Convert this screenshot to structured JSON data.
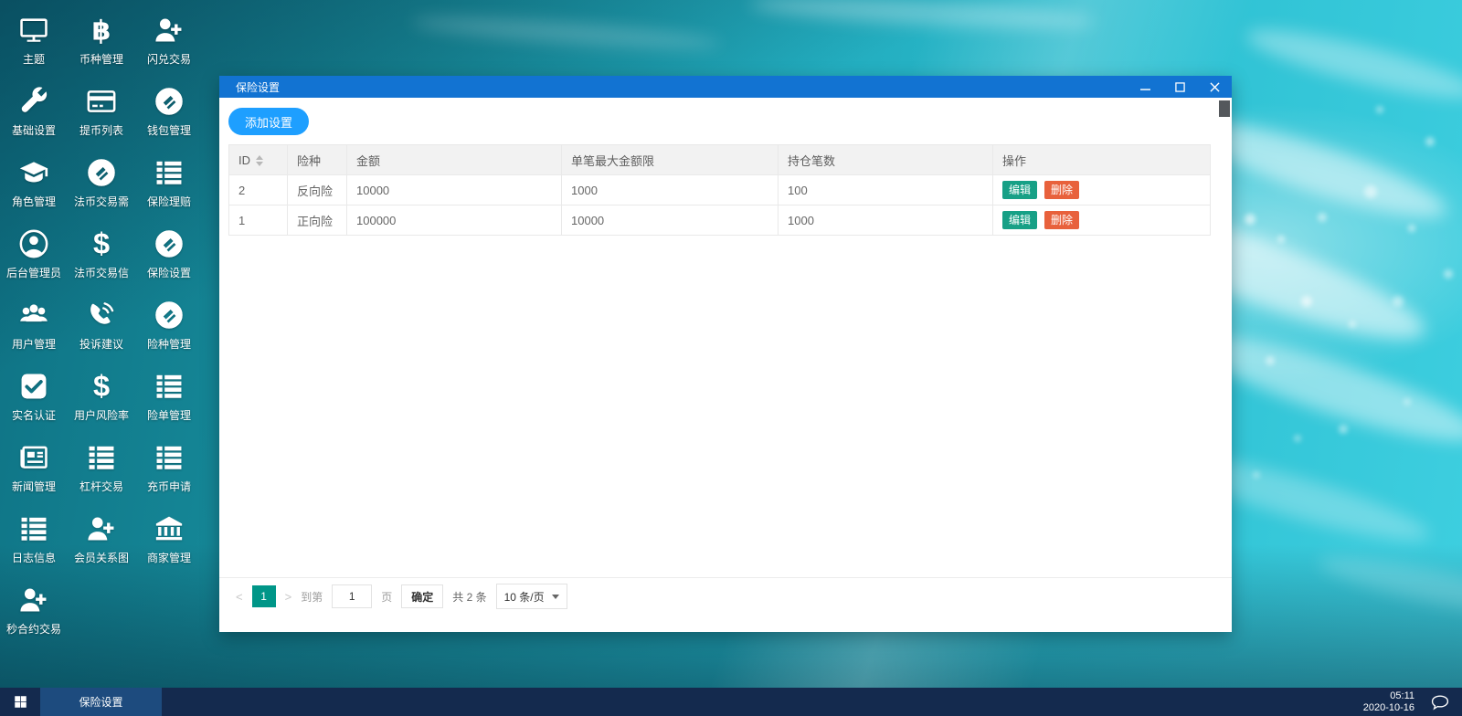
{
  "desktop": {
    "sidebar_items": [
      {
        "label": "主题",
        "icon": "monitor"
      },
      {
        "label": "币种管理",
        "icon": "bitcoin"
      },
      {
        "label": "闪兑交易",
        "icon": "user-plus"
      },
      {
        "label": "基础设置",
        "icon": "wrench"
      },
      {
        "label": "提币列表",
        "icon": "credit-card"
      },
      {
        "label": "钱包管理",
        "icon": "coin"
      },
      {
        "label": "角色管理",
        "icon": "graduation-cap"
      },
      {
        "label": "法币交易需",
        "icon": "coin"
      },
      {
        "label": "保险理赔",
        "icon": "list"
      },
      {
        "label": "后台管理员",
        "icon": "user-circle"
      },
      {
        "label": "法币交易信",
        "icon": "dollar"
      },
      {
        "label": "保险设置",
        "icon": "coin"
      },
      {
        "label": "用户管理",
        "icon": "users"
      },
      {
        "label": "投诉建议",
        "icon": "phone"
      },
      {
        "label": "险种管理",
        "icon": "coin"
      },
      {
        "label": "实名认证",
        "icon": "check-square"
      },
      {
        "label": "用户风险率",
        "icon": "dollar"
      },
      {
        "label": "险单管理",
        "icon": "list"
      },
      {
        "label": "新闻管理",
        "icon": "newspaper"
      },
      {
        "label": "杠杆交易",
        "icon": "list"
      },
      {
        "label": "充币申请",
        "icon": "list"
      },
      {
        "label": "日志信息",
        "icon": "list"
      },
      {
        "label": "会员关系图",
        "icon": "user-plus"
      },
      {
        "label": "商家管理",
        "icon": "bank"
      },
      {
        "label": "秒合约交易",
        "icon": "user-plus"
      }
    ]
  },
  "window": {
    "title": "保险设置",
    "toolbar": {
      "add_button": "添加设置"
    },
    "table": {
      "columns": [
        {
          "label": "ID",
          "sortable": true
        },
        {
          "label": "险种"
        },
        {
          "label": "金额"
        },
        {
          "label": "单笔最大金额限"
        },
        {
          "label": "持仓笔数"
        },
        {
          "label": "操作"
        }
      ],
      "rows": [
        {
          "cells": [
            "2",
            "反向险",
            "10000",
            "1000",
            "100"
          ]
        },
        {
          "cells": [
            "1",
            "正向险",
            "100000",
            "10000",
            "1000"
          ]
        }
      ],
      "row_actions": {
        "edit": "编辑",
        "delete": "删除"
      }
    },
    "pagination": {
      "prev": "<",
      "next": ">",
      "current_page": "1",
      "goto_label": "到第",
      "page_input": "1",
      "page_label": "页",
      "confirm": "确定",
      "total": "共 2 条",
      "page_size": "10 条/页"
    }
  },
  "taskbar": {
    "active_task": "保险设置",
    "clock": {
      "time": "05:11",
      "date": "2020-10-16"
    }
  },
  "colors": {
    "titlebar": "#1273d2",
    "add_button": "#1e9fff",
    "edit_button": "#17a086",
    "delete_button": "#e8613c",
    "active_page": "#009688",
    "taskbar": "#142a4e",
    "taskbar_active": "#1d4b7e"
  }
}
